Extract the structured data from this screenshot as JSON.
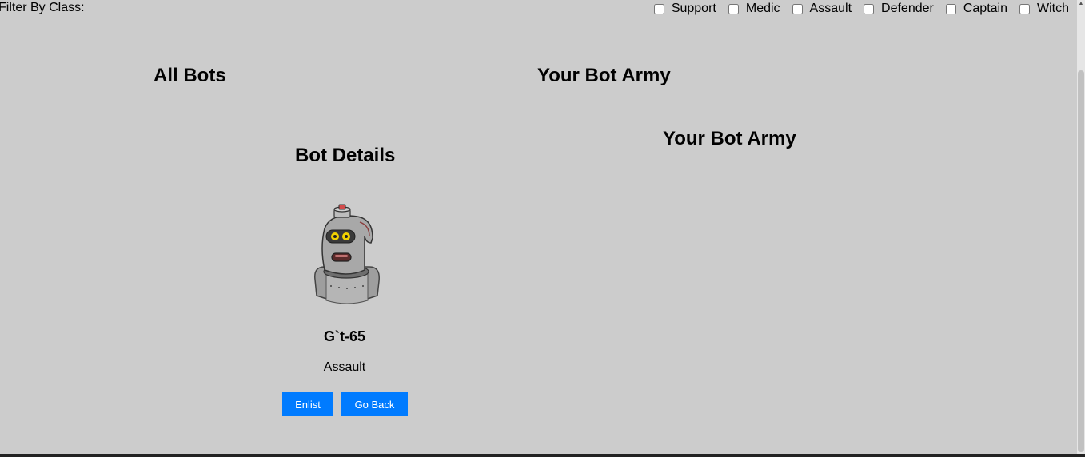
{
  "filter": {
    "label": "Filter By Class:",
    "options": [
      {
        "label": "Support",
        "checked": false
      },
      {
        "label": "Medic",
        "checked": false
      },
      {
        "label": "Assault",
        "checked": false
      },
      {
        "label": "Defender",
        "checked": false
      },
      {
        "label": "Captain",
        "checked": false
      },
      {
        "label": "Witch",
        "checked": false
      }
    ]
  },
  "sections": {
    "all_bots": "All Bots",
    "your_bot_army": "Your Bot Army",
    "your_bot_army_inner": "Your Bot Army"
  },
  "details": {
    "title": "Bot Details",
    "bot_name": "G`t-65",
    "bot_class": "Assault",
    "avatar_icon": "robot-avatar-icon",
    "enlist_label": "Enlist",
    "go_back_label": "Go Back"
  },
  "colors": {
    "background": "#cccccc",
    "button": "#007bff",
    "button_text": "#ffffff"
  }
}
